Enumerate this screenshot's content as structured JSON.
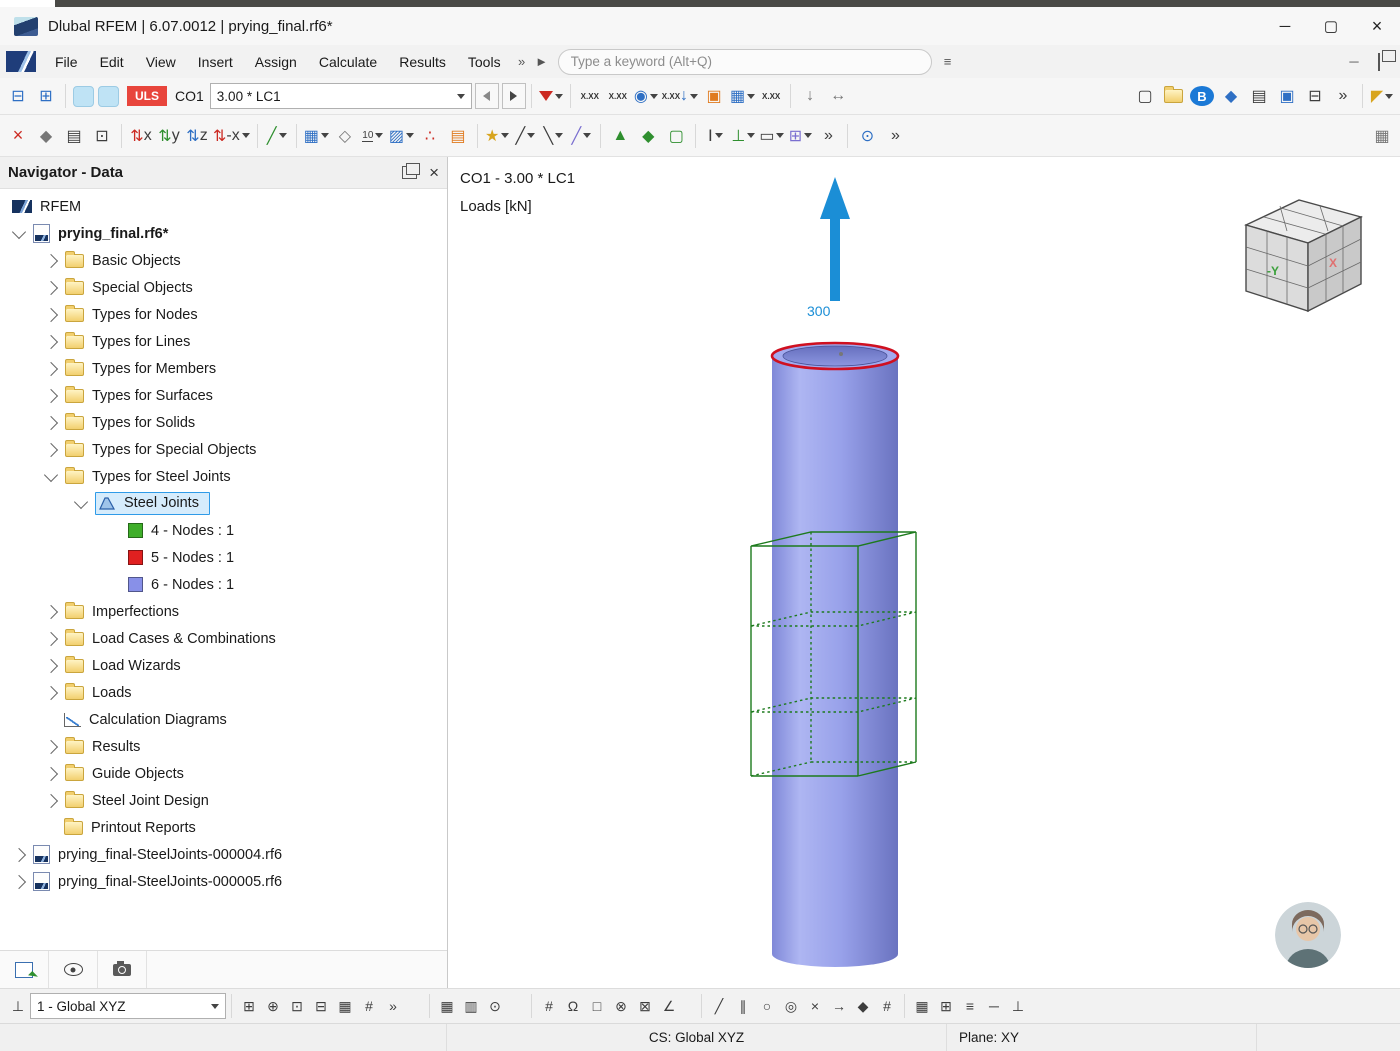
{
  "titlebar": {
    "title": "Dlubal RFEM | 6.07.0012 | prying_final.rf6*"
  },
  "menubar": {
    "items": [
      "File",
      "Edit",
      "View",
      "Insert",
      "Assign",
      "Calculate",
      "Results",
      "Tools"
    ],
    "search_placeholder": "Type a keyword (Alt+Q)"
  },
  "toolbar": {
    "uls": "ULS",
    "co": "CO1",
    "load_combo": "3.00 * LC1",
    "xxx": "X.XX",
    "dim": "10",
    "bim": "B"
  },
  "navigator": {
    "title": "Navigator - Data",
    "tree": [
      {
        "label": "RFEM"
      },
      {
        "label": "prying_final.rf6*"
      },
      {
        "label": "Basic Objects"
      },
      {
        "label": "Special Objects"
      },
      {
        "label": "Types for Nodes"
      },
      {
        "label": "Types for Lines"
      },
      {
        "label": "Types for Members"
      },
      {
        "label": "Types for Surfaces"
      },
      {
        "label": "Types for Solids"
      },
      {
        "label": "Types for Special Objects"
      },
      {
        "label": "Types for Steel Joints"
      },
      {
        "label": "Steel Joints"
      },
      {
        "label": "4 - Nodes : 1",
        "color": "#3fae2a"
      },
      {
        "label": "5 - Nodes : 1",
        "color": "#e02020"
      },
      {
        "label": "6 - Nodes : 1",
        "color": "#8890e8"
      },
      {
        "label": "Imperfections"
      },
      {
        "label": "Load Cases & Combinations"
      },
      {
        "label": "Load Wizards"
      },
      {
        "label": "Loads"
      },
      {
        "label": "Calculation Diagrams"
      },
      {
        "label": "Results"
      },
      {
        "label": "Guide Objects"
      },
      {
        "label": "Steel Joint Design"
      },
      {
        "label": "Printout Reports"
      },
      {
        "label": "prying_final-SteelJoints-000004.rf6"
      },
      {
        "label": "prying_final-SteelJoints-000005.rf6"
      }
    ]
  },
  "viewport": {
    "header_line1": "CO1 - 3.00 * LC1",
    "header_line2": "Loads [kN]",
    "load_value": "300",
    "cube": {
      "front": "-Y",
      "right": "X"
    }
  },
  "bottombar": {
    "cs_combo": "1 - Global XYZ"
  },
  "statusbar": {
    "cs": "CS: Global XYZ",
    "plane": "Plane: XY"
  },
  "colors": {
    "accent_blue": "#1b8ed6",
    "selection": "#d6ecfc",
    "uls_red": "#e8453c",
    "model_blue": "#98a1ea",
    "wire_green": "#1d7a1d",
    "top_ring_red": "#cf1020"
  }
}
